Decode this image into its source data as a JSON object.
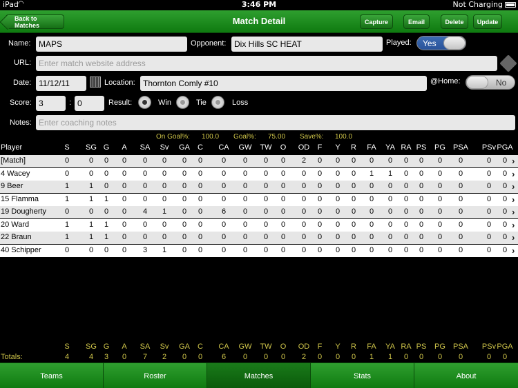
{
  "status": {
    "carrier": "iPad",
    "time": "3:46 PM",
    "battery": "Not Charging"
  },
  "nav": {
    "title": "Match Detail",
    "back": "Back to Matches",
    "capture": "Capture",
    "email": "Email",
    "delete": "Delete",
    "update": "Update"
  },
  "form": {
    "name_label": "Name:",
    "name_value": "MAPS",
    "opponent_label": "Opponent:",
    "opponent_value": "Dix Hills SC HEAT",
    "played_label": "Played:",
    "played_value": "Yes",
    "url_label": "URL:",
    "url_placeholder": "Enter match website address",
    "date_label": "Date:",
    "date_value": "11/12/11",
    "location_label": "Location:",
    "location_value": "Thornton Comly #10",
    "home_label": "@Home:",
    "home_value": "No",
    "score_label": "Score:",
    "score_home": "3",
    "score_sep": ":",
    "score_away": "0",
    "result_label": "Result:",
    "result_win": "Win",
    "result_tie": "Tie",
    "result_loss": "Loss",
    "notes_label": "Notes:",
    "notes_placeholder": "Enter coaching notes"
  },
  "summary": {
    "on_goal_label": "On Goal%:",
    "on_goal": "100.0",
    "goal_label": "Goal%:",
    "goal": "75.00",
    "save_label": "Save%:",
    "save": "100.0"
  },
  "columns": [
    "S",
    "SG",
    "G",
    "A",
    "SA",
    "Sv",
    "GA",
    "C",
    "CA",
    "GW",
    "TW",
    "O",
    "OD",
    "F",
    "Y",
    "R",
    "FA",
    "YA",
    "RA",
    "PS",
    "PG",
    "PSA",
    "PSv",
    "PGA"
  ],
  "player_header": "Player",
  "rows": [
    {
      "name": "[Match]",
      "v": [
        "0",
        "0",
        "0",
        "0",
        "0",
        "0",
        "0",
        "0",
        "0",
        "0",
        "0",
        "0",
        "2",
        "0",
        "0",
        "0",
        "0",
        "0",
        "0",
        "0",
        "0",
        "0",
        "0",
        "0"
      ]
    },
    {
      "name": "4 Wacey",
      "v": [
        "0",
        "0",
        "0",
        "0",
        "0",
        "0",
        "0",
        "0",
        "0",
        "0",
        "0",
        "0",
        "0",
        "0",
        "0",
        "0",
        "1",
        "1",
        "0",
        "0",
        "0",
        "0",
        "0",
        "0"
      ]
    },
    {
      "name": "9 Beer",
      "v": [
        "1",
        "1",
        "0",
        "0",
        "0",
        "0",
        "0",
        "0",
        "0",
        "0",
        "0",
        "0",
        "0",
        "0",
        "0",
        "0",
        "0",
        "0",
        "0",
        "0",
        "0",
        "0",
        "0",
        "0"
      ]
    },
    {
      "name": "15 Flamma",
      "v": [
        "1",
        "1",
        "1",
        "0",
        "0",
        "0",
        "0",
        "0",
        "0",
        "0",
        "0",
        "0",
        "0",
        "0",
        "0",
        "0",
        "0",
        "0",
        "0",
        "0",
        "0",
        "0",
        "0",
        "0"
      ]
    },
    {
      "name": "19 Dougherty",
      "v": [
        "0",
        "0",
        "0",
        "0",
        "4",
        "1",
        "0",
        "0",
        "6",
        "0",
        "0",
        "0",
        "0",
        "0",
        "0",
        "0",
        "0",
        "0",
        "0",
        "0",
        "0",
        "0",
        "0",
        "0"
      ]
    },
    {
      "name": "20 Ward",
      "v": [
        "1",
        "1",
        "1",
        "0",
        "0",
        "0",
        "0",
        "0",
        "0",
        "0",
        "0",
        "0",
        "0",
        "0",
        "0",
        "0",
        "0",
        "0",
        "0",
        "0",
        "0",
        "0",
        "0",
        "0"
      ]
    },
    {
      "name": "22 Braun",
      "v": [
        "1",
        "1",
        "1",
        "0",
        "0",
        "0",
        "0",
        "0",
        "0",
        "0",
        "0",
        "0",
        "0",
        "0",
        "0",
        "0",
        "0",
        "0",
        "0",
        "0",
        "0",
        "0",
        "0",
        "0"
      ]
    },
    {
      "name": "40 Schipper",
      "v": [
        "0",
        "0",
        "0",
        "0",
        "3",
        "1",
        "0",
        "0",
        "0",
        "0",
        "0",
        "0",
        "0",
        "0",
        "0",
        "0",
        "0",
        "0",
        "0",
        "0",
        "0",
        "0",
        "0",
        "0"
      ]
    }
  ],
  "totals": {
    "label": "Totals:",
    "v": [
      "4",
      "4",
      "3",
      "0",
      "7",
      "2",
      "0",
      "0",
      "6",
      "0",
      "0",
      "0",
      "2",
      "0",
      "0",
      "0",
      "1",
      "1",
      "0",
      "0",
      "0",
      "0",
      "0",
      "0"
    ]
  },
  "tabs": [
    "Teams",
    "Roster",
    "Matches",
    "Stats",
    "About"
  ],
  "active_tab": "Matches",
  "colors": {
    "green": "#1a8a1a",
    "accent_yellow": "#d0c64a",
    "toggle_blue": "#2a539a"
  }
}
